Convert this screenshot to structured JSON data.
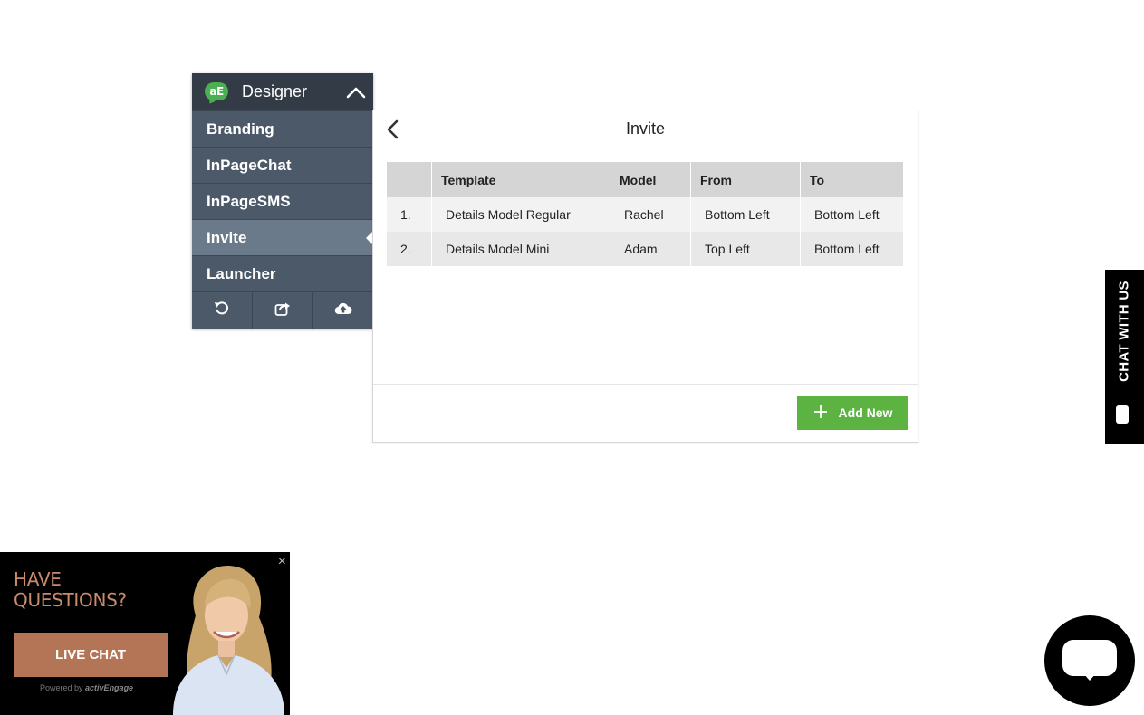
{
  "designer": {
    "title": "Designer",
    "logo_text": "aE",
    "nav": [
      {
        "label": "Branding"
      },
      {
        "label": "InPageChat"
      },
      {
        "label": "InPageSMS"
      },
      {
        "label": "Invite"
      },
      {
        "label": "Launcher"
      }
    ],
    "active_nav": "Invite",
    "toolbar_icons": [
      "undo-icon",
      "share-icon",
      "cloud-upload-icon"
    ]
  },
  "panel": {
    "title": "Invite",
    "columns": [
      "",
      "Template",
      "Model",
      "From",
      "To"
    ],
    "rows": [
      {
        "num": "1.",
        "template": "Details Model Regular",
        "model": "Rachel",
        "from": "Bottom Left",
        "to": "Bottom Left"
      },
      {
        "num": "2.",
        "template": "Details Model Mini",
        "model": "Adam",
        "from": "Top Left",
        "to": "Bottom Left"
      }
    ],
    "add_new_label": "Add New"
  },
  "chat_tab": {
    "label": "CHAT WITH US"
  },
  "promo": {
    "headline": "HAVE QUESTIONS?",
    "button_label": "LIVE CHAT",
    "powered_prefix": "Powered by",
    "powered_brand": "activEngage",
    "close_glyph": "×"
  },
  "colors": {
    "sidebar_header": "#333c46",
    "sidebar_item": "#4b5969",
    "sidebar_active": "#6b7a8a",
    "add_button": "#5db342",
    "promo_accent": "#b47556"
  }
}
